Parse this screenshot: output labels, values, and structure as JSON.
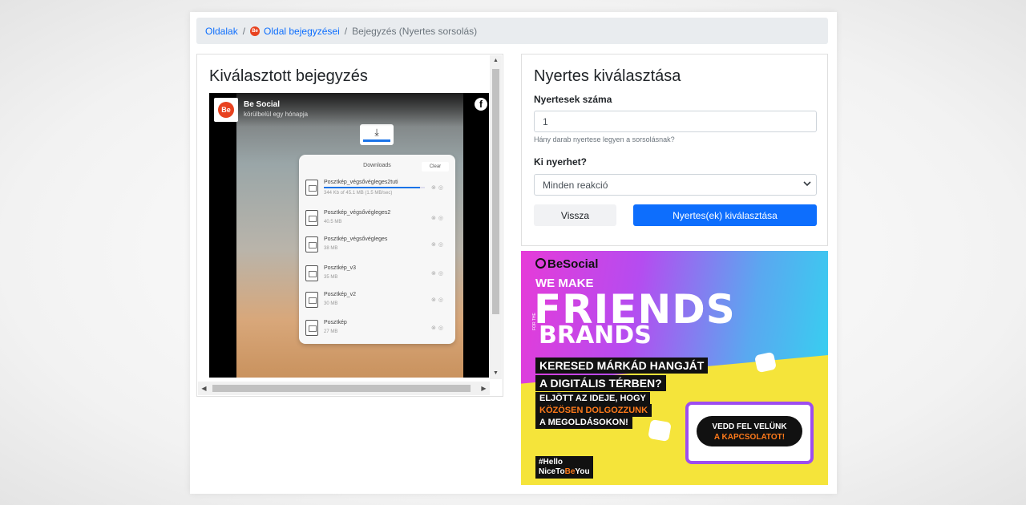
{
  "breadcrumb": {
    "item1": "Oldalak",
    "item2": "Oldal bejegyzései",
    "item3": "Bejegyzés (Nyertes sorsolás)",
    "sep": "/",
    "item2_icon": "besocial-logo-icon"
  },
  "left_card": {
    "title": "Kiválasztott bejegyzés",
    "post": {
      "page_name": "Be Social",
      "time": "körülbelül egy hónapja",
      "logo_text": "Be",
      "fb_glyph": "f",
      "downloads": {
        "title": "Downloads",
        "clear_label": "Clear",
        "items": [
          {
            "name": "Posztkép_végsővégleges2tuti",
            "size": "344 Kb of 45.1 MB (1.5 MB/sec)",
            "progress": 0.95
          },
          {
            "name": "Posztkép_végsővégleges2",
            "size": "40.5 MB"
          },
          {
            "name": "Posztkép_végsővégleges",
            "size": "38 MB"
          },
          {
            "name": "Posztkép_v3",
            "size": "35 MB"
          },
          {
            "name": "Posztkép_v2",
            "size": "30 MB"
          },
          {
            "name": "Posztkép",
            "size": "27 MB"
          }
        ]
      }
    }
  },
  "right_card": {
    "title": "Nyertes kiválasztása",
    "winners_label": "Nyertesek száma",
    "winners_value": "1",
    "winners_help": "Hány darab nyertese legyen a sorsolásnak?",
    "who_label": "Ki nyerhet?",
    "who_value": "Minden reakció",
    "back_label": "Vissza",
    "submit_label": "Nyertes(ek) kiválasztása"
  },
  "ad": {
    "brand": "BeSocial",
    "line1": "WE MAKE",
    "line2": "FRIENDS",
    "for_the": "FOR THE",
    "line3": "BRANDS",
    "q1": "KERESED MÁRKÁD HANGJÁT",
    "q2": "A DIGITÁLIS TÉRBEN?",
    "t1": "ELJÖTT AZ IDEJE, HOGY",
    "t2": "KÖZÖSEN DOLGOZZUNK",
    "t3": "A MEGOLDÁSOKON!",
    "cta1": "VEDD FEL VELÜNK",
    "cta2": "A KAPCSOLATOT!",
    "hash1": "#Hello",
    "hash2a": "NiceTo",
    "hash2b": "Be",
    "hash2c": "You"
  }
}
